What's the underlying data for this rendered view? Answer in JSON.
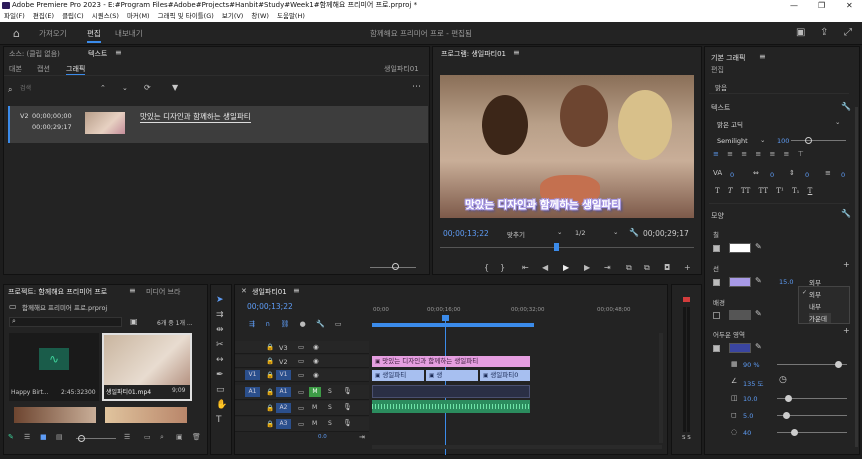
{
  "title_bar": {
    "title": "Adobe Premiere Pro 2023 - E:#Program Files#Adobe#Projects#Hanbit#Study#Week1#함께해요 프리미어 프로.prproj *"
  },
  "menu": [
    "파일(F)",
    "편집(E)",
    "클립(C)",
    "시퀀스(S)",
    "마커(M)",
    "그래픽 및 타이틀(G)",
    "보기(V)",
    "창(W)",
    "도움말(H)"
  ],
  "workspace": {
    "tabs": [
      "가져오기",
      "편집",
      "내보내기"
    ],
    "active": "편집",
    "project_name": "함께해요 프리미어 프로 - 편집됨"
  },
  "source_panel": {
    "tabs": [
      "소스: (클립 없음)",
      "텍스트"
    ],
    "subtabs": [
      "대본",
      "캡션",
      "그래픽"
    ],
    "active_subtab": "그래픽",
    "sequence_label": "생일파티01",
    "search_placeholder": "검색",
    "item": {
      "track": "V2",
      "tc_in": "00;00;00;00",
      "tc_out": "00;00;29;17",
      "text": "맛있는 디자인과 함께하는 생일파티"
    }
  },
  "program_monitor": {
    "title": "프로그램: 생일파티01",
    "caption": "맛있는 디자인과 함께하는 생일파티",
    "timecode": "00;00;13;22",
    "fit": "맞추기",
    "resolution": "1/2",
    "duration": "00;00;29;17"
  },
  "project_panel": {
    "tabs": [
      "프로젝트: 함께해요 프리미어 프로",
      "미디어 브라"
    ],
    "file": "함께해요 프리미어 프로.prproj",
    "count": "6개 중 1개 ...",
    "items": [
      {
        "name": "Happy Birt...",
        "duration": "2:45:32300"
      },
      {
        "name": "생일파티01.mp4",
        "duration": "9;09"
      }
    ]
  },
  "timeline": {
    "tab": "생일파티01",
    "timecode": "00;00;13;22",
    "ruler": [
      "00;00",
      "00;00;16;00",
      "00;00;32;00",
      "00;00;48;00"
    ],
    "tracks": [
      {
        "name": "V3",
        "source": ""
      },
      {
        "name": "V2",
        "source": ""
      },
      {
        "name": "V1",
        "source": "V1"
      },
      {
        "name": "A1",
        "source": "A1"
      },
      {
        "name": "A2",
        "source": ""
      },
      {
        "name": "A3",
        "source": ""
      }
    ],
    "clips": {
      "graphic": "맛있는 디자인과 함께하는 생일파티",
      "video1": "생일파티",
      "video2": "생",
      "video3": "생일파티0"
    },
    "mix_value": "0.0",
    "meter_labels": [
      "S",
      "S"
    ]
  },
  "essential_graphics": {
    "title": "기본 그래픽",
    "sub": "편집",
    "layer": "맑음",
    "text_section": "텍스트",
    "font": "맑은 고딕",
    "style": "Semilight",
    "size": "100",
    "track_val1": "0",
    "track_val2": "0",
    "track_val3": "0",
    "track_val4": "0",
    "appearance": "모양",
    "fill": "칠",
    "stroke": "선",
    "stroke_width": "15.0",
    "stroke_pos": "외부",
    "dropdown": [
      "외부",
      "내부",
      "가운데"
    ],
    "background": "배경",
    "shadow": "어두운 영역",
    "shadow_opacity": "90 %",
    "shadow_angle": "135 도",
    "shadow_distance": "10.0",
    "shadow_size": "5.0",
    "shadow_blur": "40",
    "colors": {
      "fill": "#ffffff",
      "stroke": "#a89ae6",
      "shadow": "#3a45a0",
      "accent": "#3b8bea"
    }
  }
}
